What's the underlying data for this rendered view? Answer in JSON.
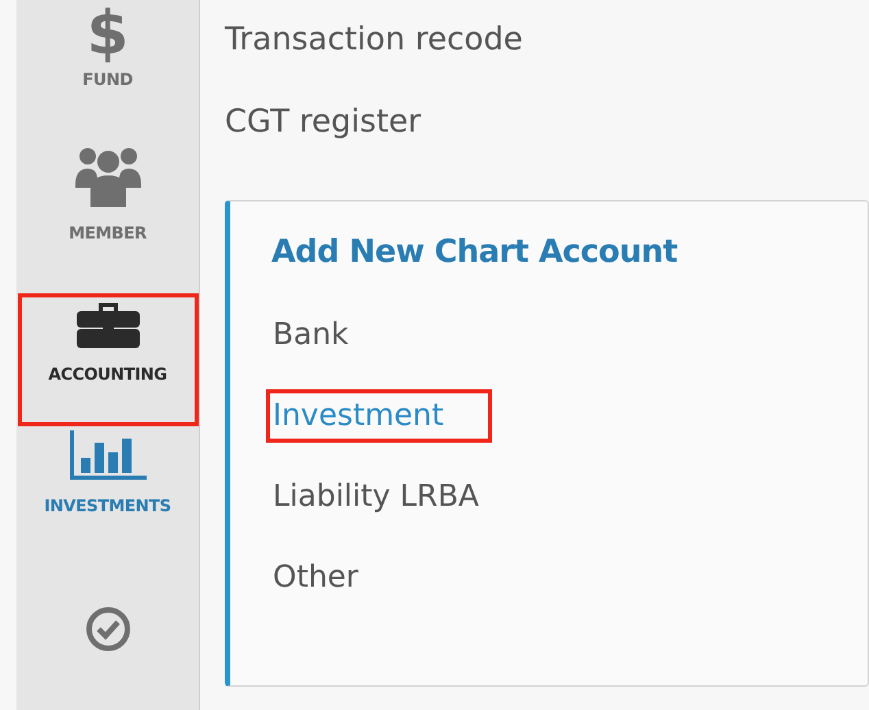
{
  "sidebar": {
    "items": [
      {
        "kind": "dollar",
        "glyph": "$",
        "label": "FUND",
        "selected": false,
        "highlighted": false
      },
      {
        "kind": "people",
        "label": "MEMBER",
        "selected": false,
        "highlighted": false
      },
      {
        "kind": "briefcase",
        "label": "ACCOUNTING",
        "selected": false,
        "highlighted": true
      },
      {
        "kind": "chart",
        "label": "INVESTMENTS",
        "selected": true,
        "highlighted": false
      },
      {
        "kind": "check",
        "selected": false,
        "highlighted": false
      }
    ]
  },
  "links": [
    "Transaction recode",
    "CGT register"
  ],
  "card": {
    "title": "Add New Chart Account",
    "items": [
      {
        "label": "Bank",
        "selected": false,
        "highlighted": false
      },
      {
        "label": "Investment",
        "selected": true,
        "highlighted": true
      },
      {
        "label": "Liability LRBA",
        "selected": false,
        "highlighted": false
      },
      {
        "label": "Other",
        "selected": false,
        "highlighted": false
      }
    ]
  }
}
